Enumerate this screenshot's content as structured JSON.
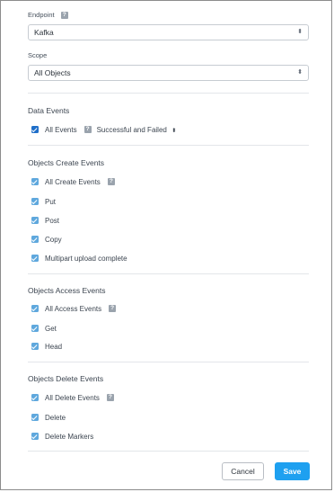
{
  "colors": {
    "checkbox_main": "#1f6fc9",
    "checkbox_sub": "#5fa8dd",
    "primary_button": "#1ea0f0"
  },
  "endpoint": {
    "label": "Endpoint",
    "value": "Kafka",
    "help_icon": "help-icon"
  },
  "scope": {
    "label": "Scope",
    "value": "All Objects"
  },
  "data_events": {
    "title": "Data Events",
    "all_events_label": "All Events",
    "status_filter": "Successful and Failed"
  },
  "create_events": {
    "title": "Objects Create Events",
    "items": [
      {
        "label": "All Create Events",
        "checked": true,
        "help": true
      },
      {
        "label": "Put",
        "checked": true
      },
      {
        "label": "Post",
        "checked": true
      },
      {
        "label": "Copy",
        "checked": true
      },
      {
        "label": "Multipart upload complete",
        "checked": true
      }
    ]
  },
  "access_events": {
    "title": "Objects Access Events",
    "items": [
      {
        "label": "All Access Events",
        "checked": true,
        "help": true
      },
      {
        "label": "Get",
        "checked": true
      },
      {
        "label": "Head",
        "checked": true
      }
    ]
  },
  "delete_events": {
    "title": "Objects Delete Events",
    "items": [
      {
        "label": "All Delete Events",
        "checked": true,
        "help": true
      },
      {
        "label": "Delete",
        "checked": true
      },
      {
        "label": "Delete Markers",
        "checked": true
      }
    ]
  },
  "footer": {
    "cancel_label": "Cancel",
    "save_label": "Save"
  }
}
